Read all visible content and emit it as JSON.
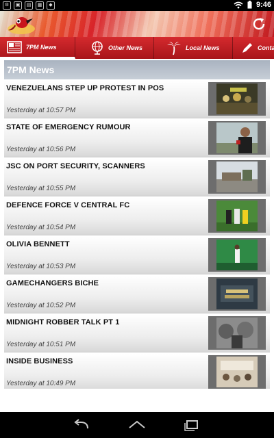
{
  "status_bar": {
    "icons": [
      "cog-icon",
      "photo-icon",
      "sim-icon",
      "calendar-icon",
      "shield-icon",
      "wifi-icon",
      "battery-icon"
    ],
    "time": "9:46"
  },
  "tabs": [
    {
      "label": "7PM News",
      "icon": "newspaper-icon",
      "active": true
    },
    {
      "label": "Other News",
      "icon": "globe-icon",
      "active": false
    },
    {
      "label": "Local News",
      "icon": "palm-tree-icon",
      "active": false
    },
    {
      "label": "Conta",
      "icon": "pencil-icon",
      "active": false
    }
  ],
  "section": {
    "title": "7PM News"
  },
  "news": [
    {
      "title": "VENEZUELANS STEP UP PROTEST IN POS",
      "time": "Yesterday at 10:57 PM"
    },
    {
      "title": "STATE OF EMERGENCY RUMOUR",
      "time": "Yesterday at 10:56 PM"
    },
    {
      "title": " JSC ON PORT SECURITY, SCANNERS",
      "time": "Yesterday at 10:55 PM"
    },
    {
      "title": "DEFENCE FORCE V CENTRAL FC",
      "time": "Yesterday at 10:54 PM"
    },
    {
      "title": " OLIVIA BENNETT",
      "time": "Yesterday at 10:53 PM"
    },
    {
      "title": " GAMECHANGERS BICHE",
      "time": "Yesterday at 10:52 PM"
    },
    {
      "title": "MIDNIGHT ROBBER TALK PT 1",
      "time": "Yesterday at 10:51 PM"
    },
    {
      "title": " INSIDE BUSINESS",
      "time": "Yesterday at 10:49 PM"
    }
  ],
  "colors": {
    "accent_red": "#c8161d",
    "section_bar": "#b6bec9"
  },
  "nav": {
    "buttons": [
      "back-icon",
      "home-icon",
      "recent-apps-icon"
    ]
  }
}
